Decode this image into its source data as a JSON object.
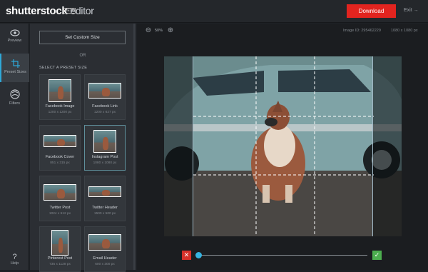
{
  "header": {
    "logo": "shutterstock",
    "editor": "editor",
    "beta": "BETA",
    "download_label": "Download",
    "exit_label": "Exit",
    "brand_color": "#e2241f"
  },
  "rail": {
    "items": [
      {
        "label": "Preview",
        "icon": "eye-icon"
      },
      {
        "label": "Preset Sizes",
        "icon": "crop-icon"
      },
      {
        "label": "Filters",
        "icon": "filters-icon"
      }
    ],
    "help_label": "Help"
  },
  "panel": {
    "custom_size_label": "Set Custom Size",
    "or_label": "OR",
    "preset_heading": "SELECT A PRESET SIZE",
    "presets": [
      {
        "name": "Facebook Image",
        "dims": "1200 x 1200 px"
      },
      {
        "name": "Facebook Link",
        "dims": "1200 x 627 px"
      },
      {
        "name": "Facebook Cover",
        "dims": "851 x 315 px"
      },
      {
        "name": "Instagram Post",
        "dims": "1080 x 1080 px"
      },
      {
        "name": "Twitter Post",
        "dims": "1024 x 512 px"
      },
      {
        "name": "Twitter Header",
        "dims": "1500 x 500 px"
      },
      {
        "name": "Pinterest Post",
        "dims": "735 x 1128 px"
      },
      {
        "name": "Email Header",
        "dims": "600 x 300 px"
      }
    ],
    "selected_preset": "Instagram Post"
  },
  "workspace": {
    "zoom_level": "50%",
    "image_id": "Image ID: 295462229",
    "image_size": "1080 x 1080 px",
    "zoom_slider_value": 0.0,
    "accent_color": "#36b3e0"
  }
}
